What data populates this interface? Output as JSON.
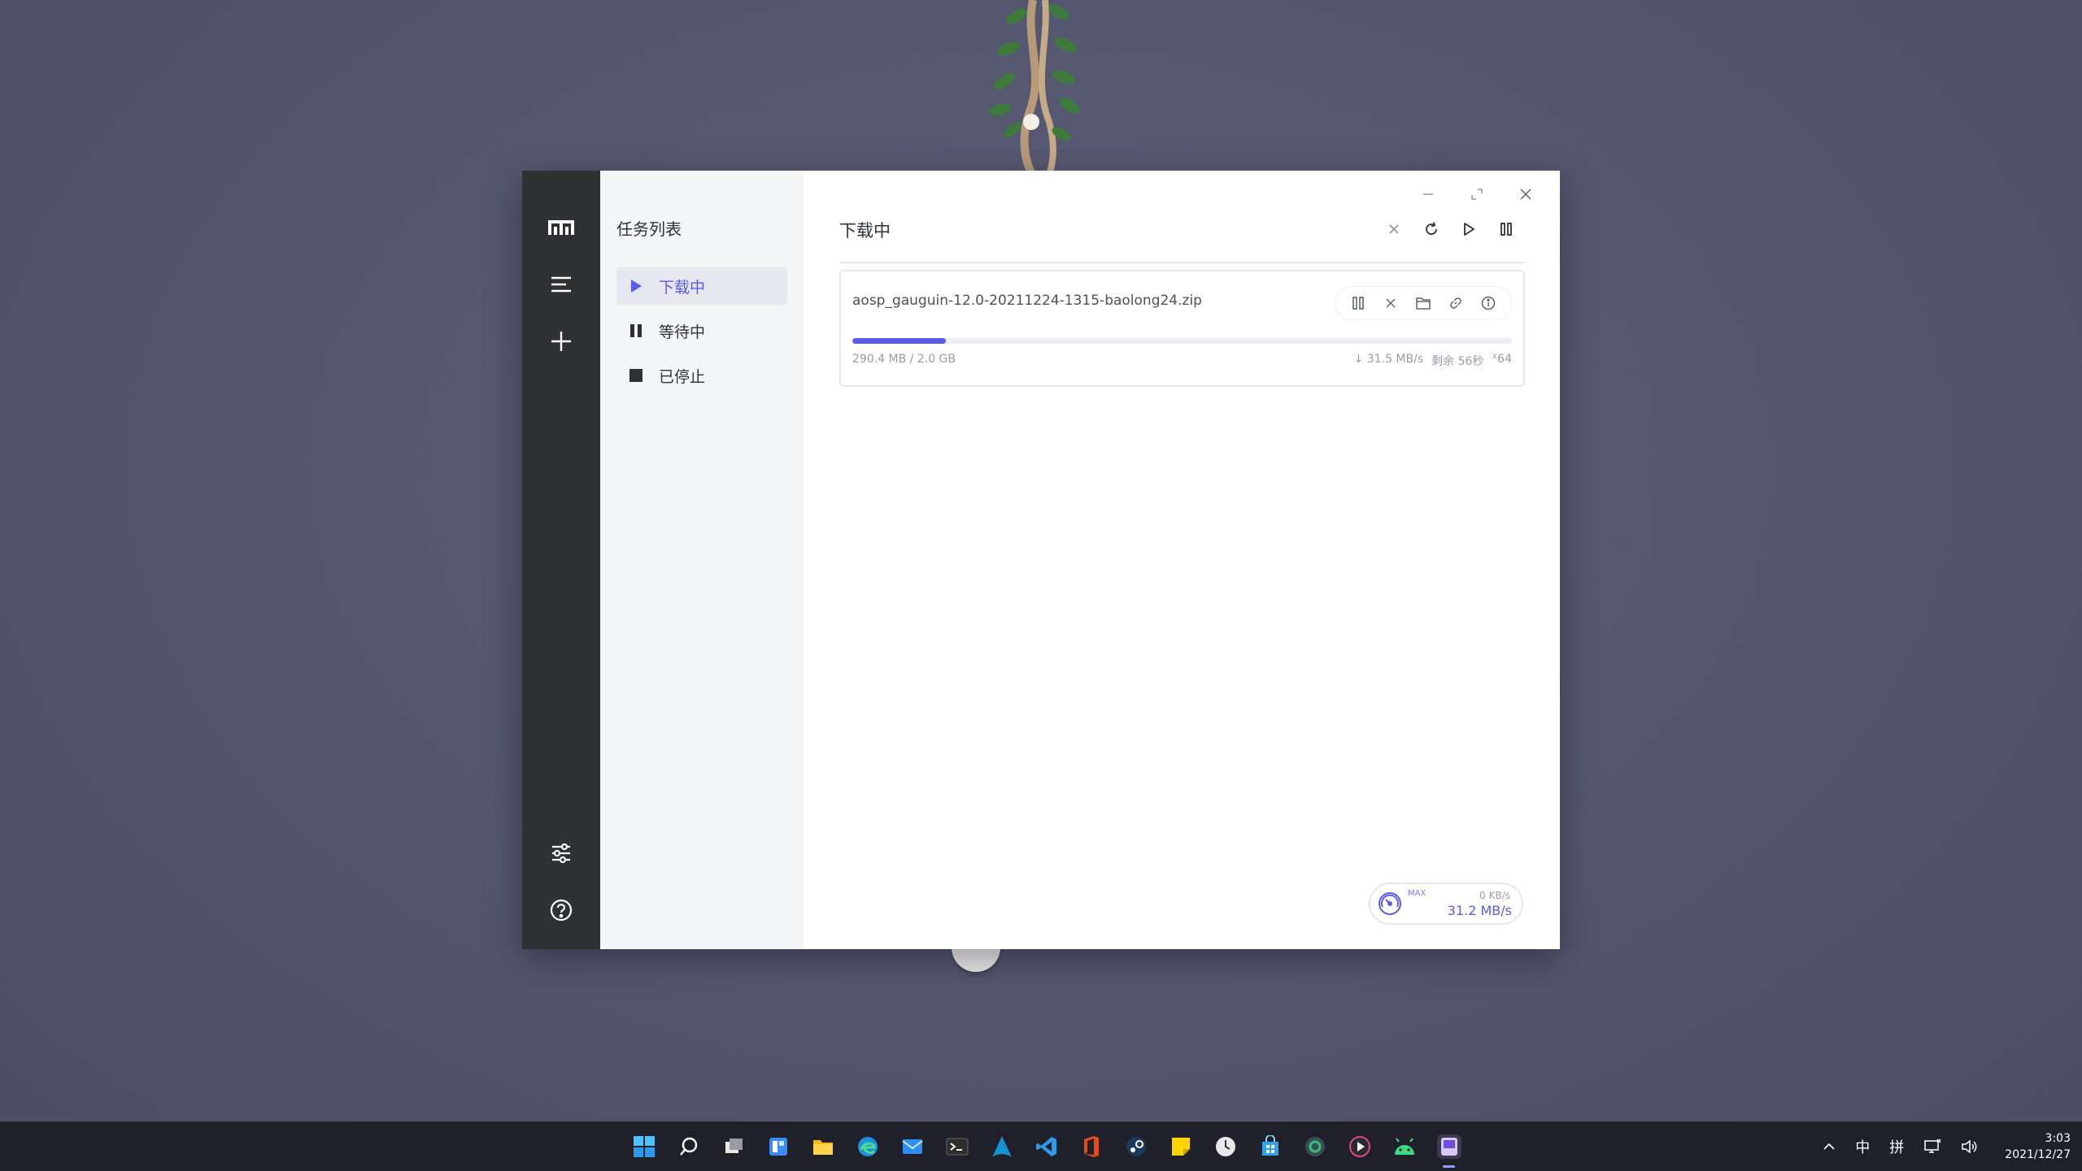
{
  "window": {
    "sidebar_title": "任务列表",
    "nav": [
      {
        "label": "下载中",
        "icon": "play-icon",
        "active": true
      },
      {
        "label": "等待中",
        "icon": "pause-icon",
        "active": false
      },
      {
        "label": "已停止",
        "icon": "stop-icon",
        "active": false
      }
    ],
    "rail_icons": [
      "motrix-logo-icon",
      "menu-icon",
      "add-icon",
      "preferences-icon",
      "help-icon"
    ],
    "header_title": "下载中",
    "header_tools": [
      "close-icon",
      "refresh-icon",
      "play-icon",
      "pause-icon"
    ]
  },
  "task": {
    "filename": "aosp_gauguin-12.0-20211224-1315-baolong24.zip",
    "size": "290.4 MB / 2.0 GB",
    "progress": 0.1418,
    "speed": "↓ 31.5 MB/s",
    "remaining": "剩余 56秒",
    "connections": "64",
    "actions": [
      "pause-icon",
      "delete-icon",
      "folder-icon",
      "link-icon",
      "info-icon"
    ]
  },
  "speedometer": {
    "mode": "MAX",
    "upload": "0 KB/s",
    "download": "31.2 MB/s"
  },
  "taskbar": {
    "apps": [
      "windows-start-icon",
      "search-icon",
      "task-view-icon",
      "widgets-icon",
      "file-explorer-icon",
      "edge-icon",
      "mail-icon",
      "terminal-icon",
      "arch-icon",
      "vscode-icon",
      "office-icon",
      "steam-icon",
      "sticky-notes-icon",
      "clock-icon",
      "store-icon",
      "qq-music-icon",
      "media-player-icon",
      "android-studio-icon",
      "motrix-icon"
    ],
    "tray_ime": "中",
    "tray_ime_mode": "拼",
    "time": "3:03",
    "date": "2021/12/27"
  },
  "colors": {
    "accent": "#5b5bea",
    "rail": "#303133",
    "subnav": "#f4f5f7"
  }
}
